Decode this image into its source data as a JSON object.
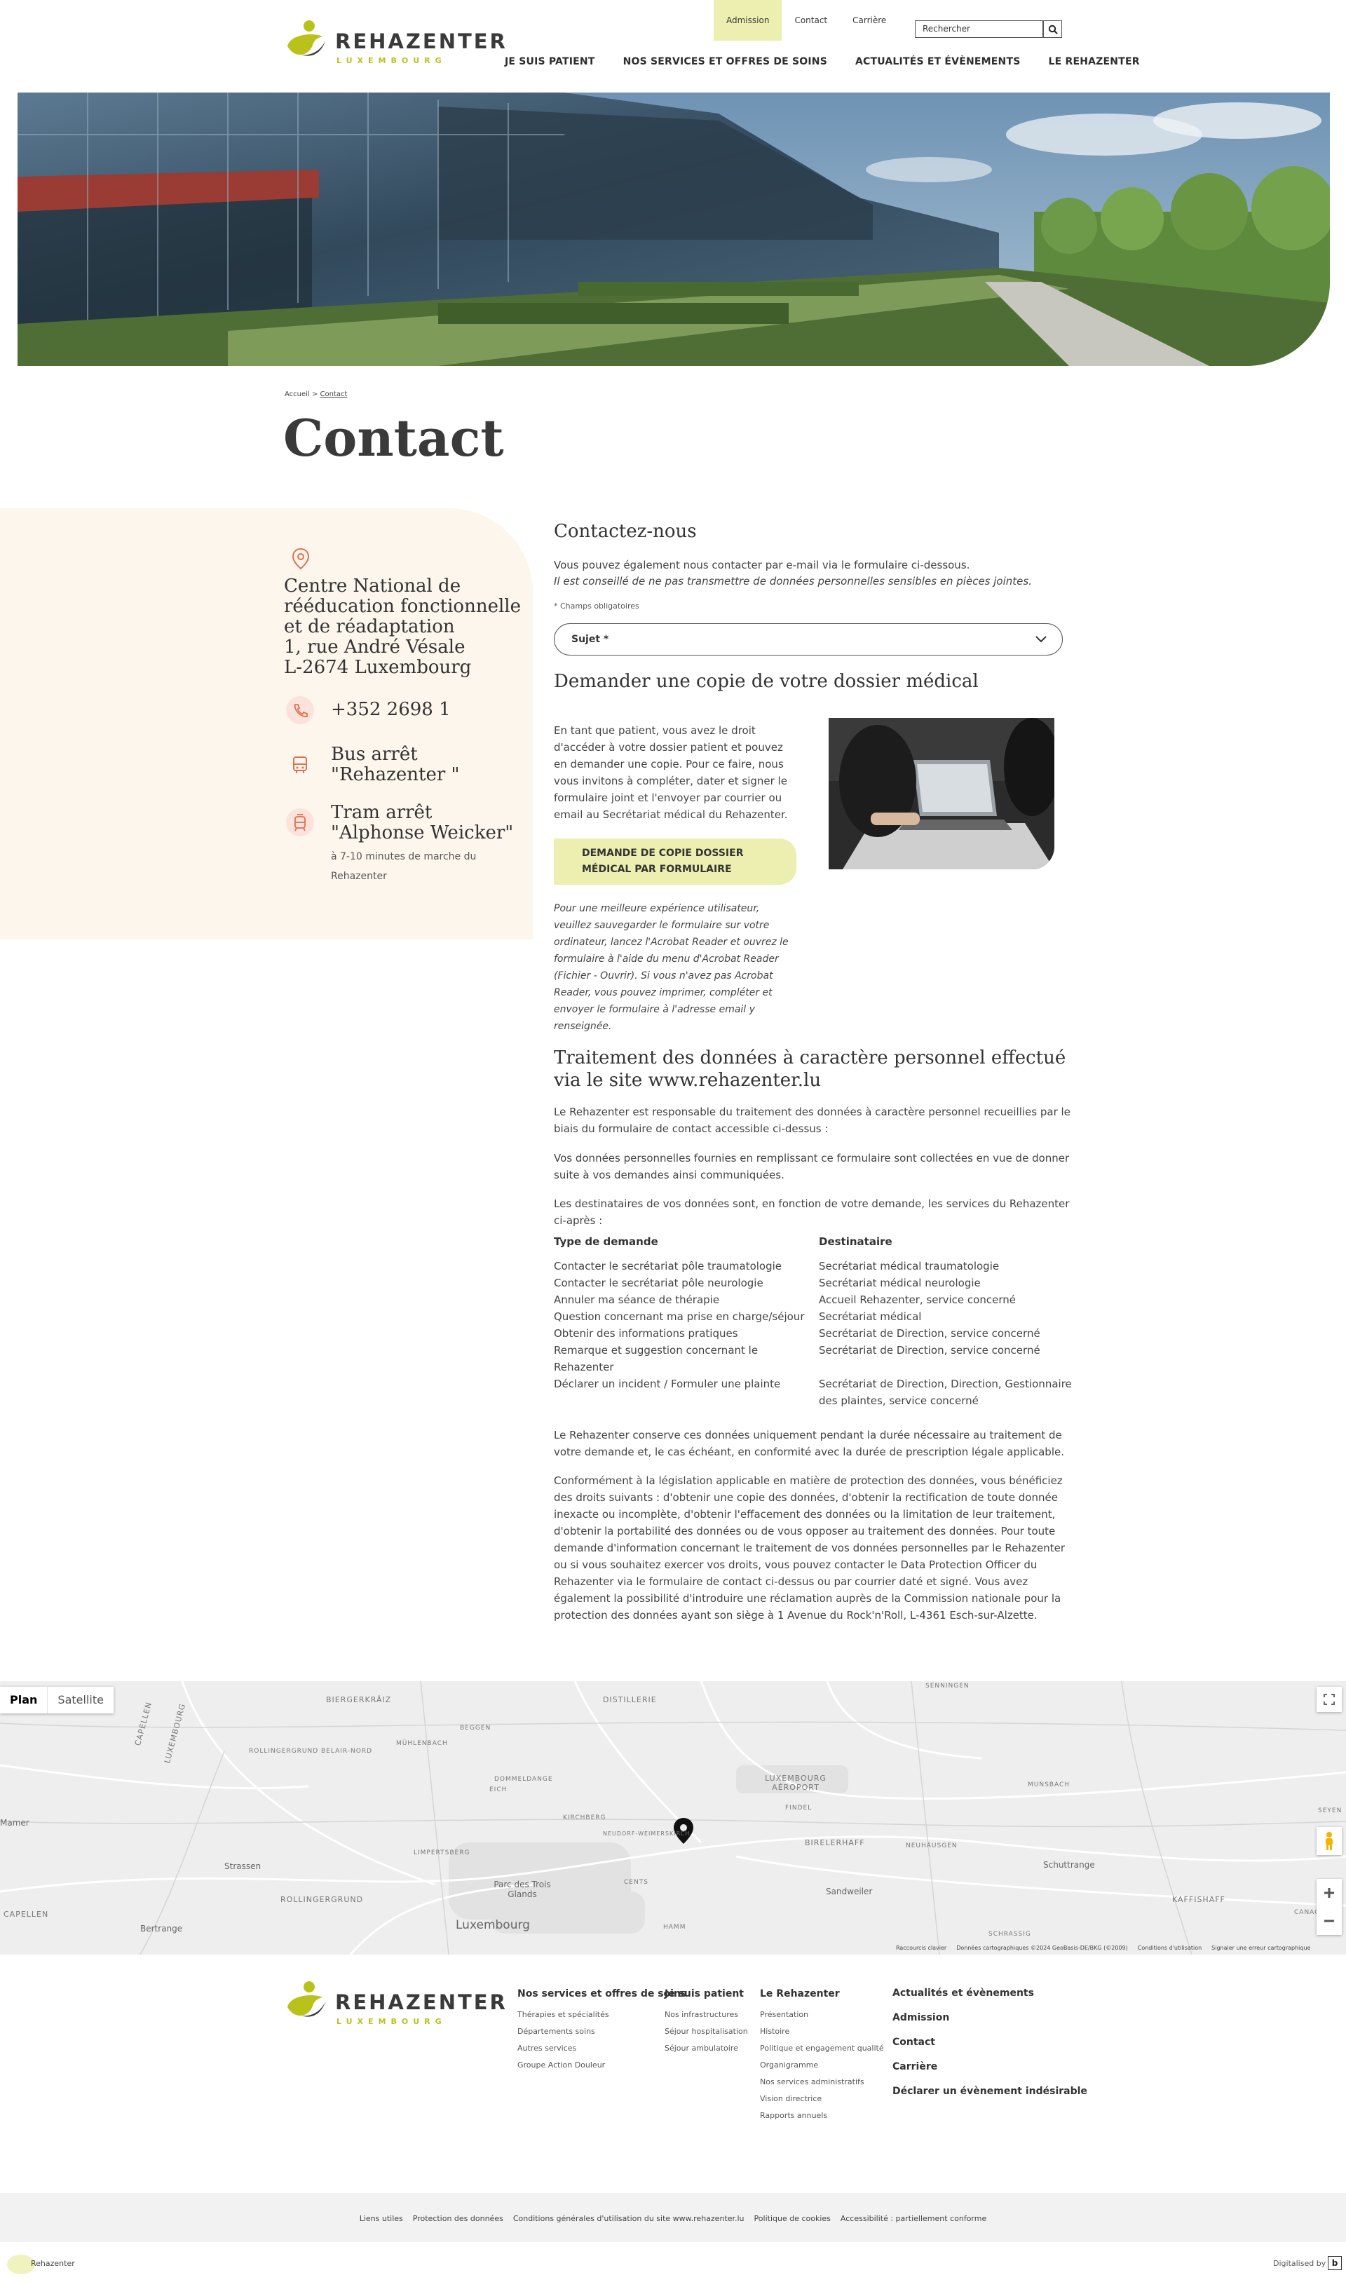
{
  "header": {
    "logo_name": "REHAZENTER",
    "logo_sub": "LUXEMBOURG",
    "top_nav": [
      "Admission",
      "Contact",
      "Carrière"
    ],
    "search_placeholder": "Rechercher",
    "main_nav": [
      "JE SUIS PATIENT",
      "NOS SERVICES ET OFFRES DE SOINS",
      "ACTUALITÉS ET ÉVÈNEMENTS",
      "LE REHAZENTER"
    ]
  },
  "breadcrumb": {
    "home": "Accueil",
    "separator": ">",
    "current": "Contact"
  },
  "page_title": "Contact",
  "info": {
    "address_name": "Centre National de rééducation fonctionnelle et de réadaptation",
    "address_street": "1, rue André Vésale",
    "address_city": "L-2674 Luxembourg",
    "phone": "+352 2698 1",
    "bus_label": "Bus arrêt",
    "bus_stop": "\"Rehazenter \"",
    "tram_label": "Tram arrêt",
    "tram_stop": "\"Alphonse Weicker\"",
    "tram_note": "à 7-10 minutes de marche du Rehazenter"
  },
  "contact_form": {
    "title": "Contactez-nous",
    "intro": "Vous pouvez également nous contacter par e-mail via le formulaire ci-dessous.",
    "warning": "Il est conseillé de ne pas transmettre de données personnelles sensibles en pièces jointes.",
    "required_note": "* Champs obligatoires",
    "subject_label": "Sujet *"
  },
  "medical_copy": {
    "title": "Demander une copie de votre dossier médical",
    "text": "En tant que patient, vous avez le droit d'accéder à votre dossier patient et pouvez en demander une copie. Pour ce faire, nous vous invitons à compléter, dater et signer le formulaire joint et l'envoyer par courrier ou email au Secrétariat médical du Rehazenter.",
    "button_line1": "DEMANDE DE COPIE DOSSIER",
    "button_line2": "MÉDICAL PAR FORMULAIRE",
    "tip": "Pour une meilleure expérience utilisateur, veuillez sauvegarder le formulaire sur votre ordinateur, lancez l'Acrobat Reader et ouvrez le formulaire à l'aide du menu d'Acrobat Reader (Fichier - Ouvrir). Si vous n'avez pas Acrobat Reader, vous pouvez imprimer, compléter et envoyer le formulaire à l'adresse email y renseignée."
  },
  "privacy": {
    "title": "Traitement des données à caractère personnel effectué via le site www.rehazenter.lu",
    "p1": "Le Rehazenter est responsable du traitement des données à caractère personnel recueillies par le biais du formulaire de contact accessible ci-dessus :",
    "p2": "Vos données personnelles fournies en remplissant ce formulaire sont collectées en vue de donner suite à vos demandes ainsi communiquées.",
    "p3": "Les destinataires de vos données sont, en fonction de votre demande, les services du Rehazenter ci-après :",
    "col1_head": "Type de demande",
    "col2_head": "Destinataire",
    "rows": [
      {
        "type": "Contacter le secrétariat pôle traumatologie",
        "dest": "Secrétariat médical traumatologie"
      },
      {
        "type": "Contacter le secrétariat pôle neurologie",
        "dest": "Secrétariat médical neurologie"
      },
      {
        "type": "Annuler ma séance de thérapie",
        "dest": "Accueil Rehazenter, service concerné"
      },
      {
        "type": "Question concernant ma prise en charge/séjour",
        "dest": "Secrétariat médical"
      },
      {
        "type": "Obtenir des informations pratiques",
        "dest": "Secrétariat de Direction, service concerné"
      },
      {
        "type": "Remarque et suggestion concernant le Rehazenter",
        "dest": "Secrétariat de Direction, service concerné"
      },
      {
        "type": "Déclarer un incident / Formuler une plainte",
        "dest": "Secrétariat de Direction, Direction, Gestionnaire des plaintes, service concerné"
      }
    ],
    "p4": "Le Rehazenter conserve ces données uniquement pendant la durée nécessaire au traitement de votre demande et, le cas échéant, en conformité avec la durée de prescription légale applicable.",
    "p5": "Conformément à la législation applicable en matière de protection des données, vous bénéficiez des droits suivants : d'obtenir une copie des données, d'obtenir la rectification de toute donnée inexacte ou incomplète, d'obtenir l'effacement des données ou la limitation de leur traitement, d'obtenir la portabilité des données ou de vous opposer au traitement des données. Pour toute demande d'information concernant le traitement de vos données personnelles par le Rehazenter ou si vous souhaitez exercer vos droits, vous pouvez contacter le Data Protection Officer du Rehazenter via le formulaire de contact ci-dessus ou par courrier daté et signé. Vous avez également la possibilité d'introduire une réclamation auprès de la Commission nationale pour la protection des données ayant son siège à 1 Avenue du Rock'n'Roll, L-4361 Esch-sur-Alzette."
  },
  "map": {
    "tab_plan": "Plan",
    "tab_satellite": "Satellite",
    "labels": [
      "BIERGERKRÄIZ",
      "DISTILLERIE",
      "SENNINGEN",
      "CAPELLEN",
      "LUXEMBOURG",
      "BEGGEN",
      "MÜHLENBACH",
      "ROLLINGERGRUND BELAIR-NORD",
      "DOMMELDANGE",
      "EICH",
      "LUXEMBOURG AÉROPORT",
      "FINDEL",
      "MUNSBACH",
      "Mamer",
      "KIRCHBERG",
      "NEUDORF-WEIMERSKIRCH",
      "BIRELERHAFF",
      "NEUHÄUSGEN",
      "Strassen",
      "LIMPERTSBERG",
      "Schuttrange",
      "CENTS",
      "SEYEN",
      "Parc des Trois Glands",
      "Sandweiler",
      "KAFFISHAFF",
      "ROLLINGERGRUND",
      "CAPELLEN",
      "Bertrange",
      "Luxembourg",
      "HAMM",
      "SCHRASSIG",
      "CANACH"
    ],
    "attribution": [
      "Raccourcis clavier",
      "Données cartographiques ©2024 GeoBasis-DE/BKG (©2009)",
      "Conditions d'utilisation",
      "Signaler une erreur cartographique"
    ]
  },
  "footer": {
    "col1_head": "Nos services et offres de soins",
    "col1_links": [
      "Thérapies et spécialités",
      "Départements soins",
      "Autres services",
      "Groupe Action Douleur"
    ],
    "col2_head": "Je suis patient",
    "col2_links": [
      "Nos infrastructures",
      "Séjour hospitalisation",
      "Séjour ambulatoire"
    ],
    "col3_head": "Le Rehazenter",
    "col3_links": [
      "Présentation",
      "Histoire",
      "Politique et engagement qualité",
      "Organigramme",
      "Nos services administratifs",
      "Vision directrice",
      "Rapports annuels"
    ],
    "col4_links": [
      "Actualités et évènements",
      "Admission",
      "Contact",
      "Carrière",
      "Déclarer un évènement indésirable"
    ]
  },
  "legal": {
    "links": [
      "Liens utiles",
      "Protection des données",
      "Conditions générales d'utilisation du site www.rehazenter.lu",
      "Politique de cookies",
      "Accessibilité : partiellement conforme"
    ]
  },
  "bottom": {
    "cookie_label": "Rehazenter",
    "digitalised": "Digitalised by",
    "digitalised_mark": "b"
  },
  "colors": {
    "accent_yellow": "#ecefb0",
    "brand_green": "#b8c21a",
    "panel_bg": "#fdf6ec",
    "icon_red": "#e07050"
  }
}
